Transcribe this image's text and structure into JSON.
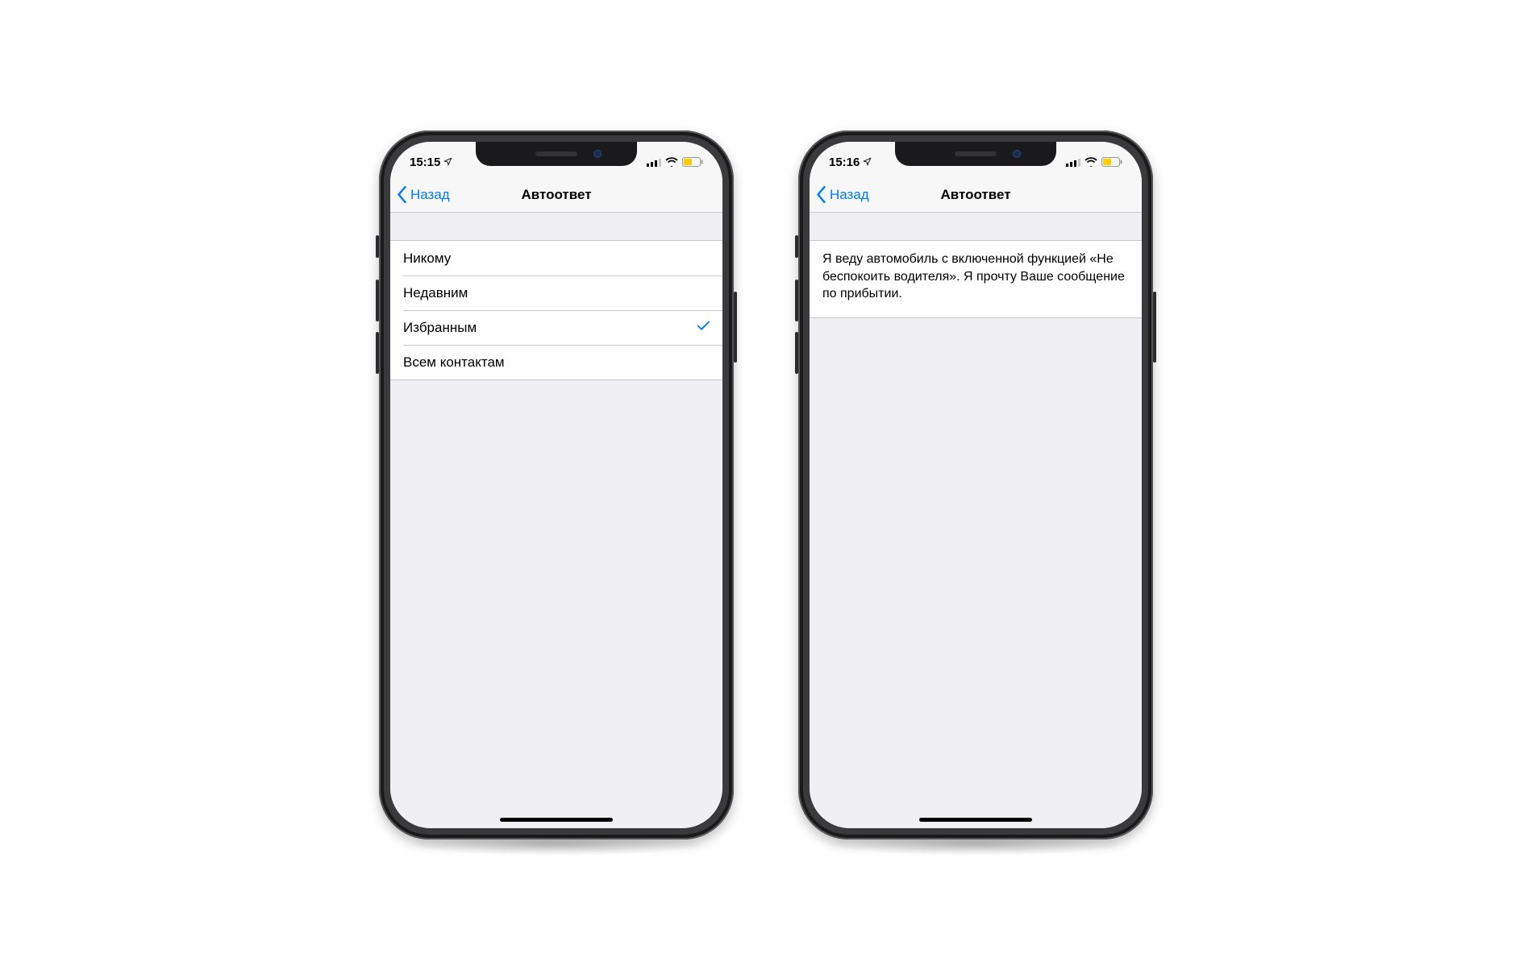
{
  "phone_left": {
    "status": {
      "time": "15:15"
    },
    "nav": {
      "back_label": "Назад",
      "title": "Автоответ"
    },
    "options": [
      {
        "label": "Никому",
        "selected": false
      },
      {
        "label": "Недавним",
        "selected": false
      },
      {
        "label": "Избранным",
        "selected": true
      },
      {
        "label": "Всем контактам",
        "selected": false
      }
    ]
  },
  "phone_right": {
    "status": {
      "time": "15:16"
    },
    "nav": {
      "back_label": "Назад",
      "title": "Автоответ"
    },
    "message_text": "Я веду автомобиль с включенной функцией «Не беспокоить водителя». Я прочту Ваше сообщение по прибытии."
  },
  "colors": {
    "ios_blue": "#007aff",
    "battery_yellow": "#ffcc00"
  }
}
